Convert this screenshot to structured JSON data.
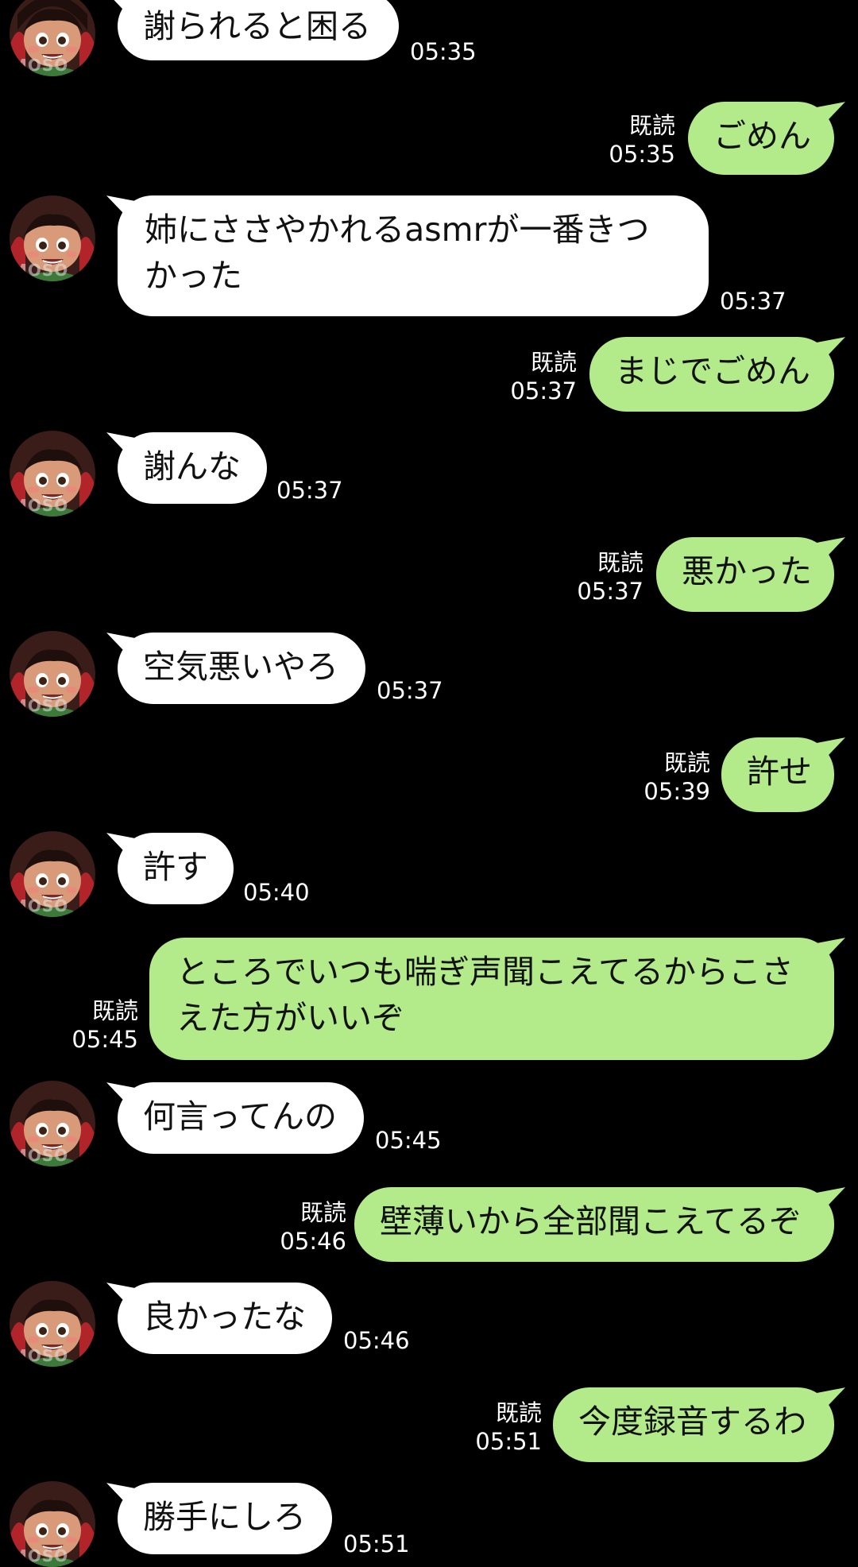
{
  "avatar": {
    "icon": "profile-girl-icon",
    "watermark": "MOSO"
  },
  "read_label": "既読",
  "messages": [
    {
      "side": "in",
      "text": "謝られると困る",
      "time": "05:35"
    },
    {
      "side": "out",
      "text": "ごめん",
      "time": "05:35",
      "read": "既読"
    },
    {
      "side": "in",
      "text": "姉にささやかれるasmrが一番きつかった",
      "time": "05:37"
    },
    {
      "side": "out",
      "text": "まじでごめん",
      "time": "05:37",
      "read": "既読"
    },
    {
      "side": "in",
      "text": "謝んな",
      "time": "05:37"
    },
    {
      "side": "out",
      "text": "悪かった",
      "time": "05:37",
      "read": "既読"
    },
    {
      "side": "in",
      "text": "空気悪いやろ",
      "time": "05:37"
    },
    {
      "side": "out",
      "text": "許せ",
      "time": "05:39",
      "read": "既読"
    },
    {
      "side": "in",
      "text": "許す",
      "time": "05:40"
    },
    {
      "side": "out",
      "text": "ところでいつも喘ぎ声聞こえてるからこさえた方がいいぞ",
      "time": "05:45",
      "read": "既読"
    },
    {
      "side": "in",
      "text": "何言ってんの",
      "time": "05:45"
    },
    {
      "side": "out",
      "text": "壁薄いから全部聞こえてるぞ",
      "time": "05:46",
      "read": "既読"
    },
    {
      "side": "in",
      "text": "良かったな",
      "time": "05:46"
    },
    {
      "side": "out",
      "text": "今度録音するわ",
      "time": "05:51",
      "read": "既読"
    },
    {
      "side": "in",
      "text": "勝手にしろ",
      "time": "05:51"
    }
  ],
  "colors": {
    "background": "#000000",
    "incoming_bubble": "#ffffff",
    "outgoing_bubble": "#b3ea8a",
    "text": "#111111",
    "meta_text": "#ffffff"
  }
}
